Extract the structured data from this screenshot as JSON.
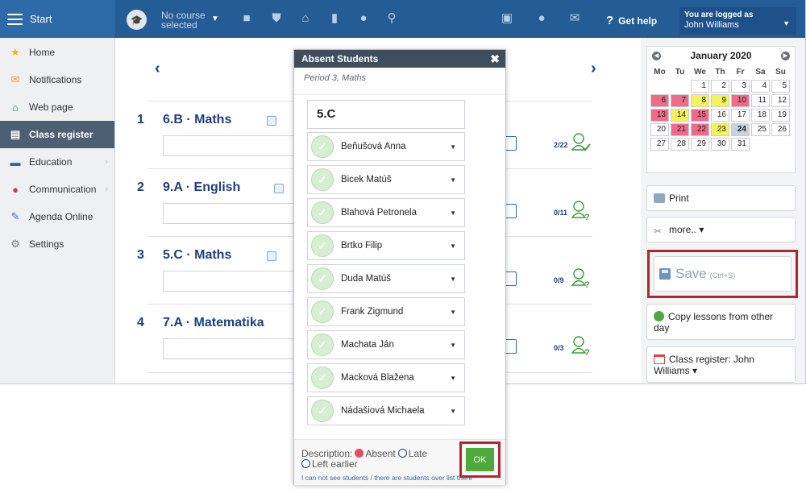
{
  "topbar": {
    "start_label": "Start",
    "course_label": "No course selected",
    "help_label": "Get help",
    "login_title": "You are logged as",
    "login_user": "John Williams",
    "icons": [
      "briefcase-icon",
      "shield-icon",
      "institution-icon",
      "chart-icon",
      "globe-icon",
      "walking-people-icon",
      "screen-icon",
      "chat-icon",
      "mail-icon"
    ]
  },
  "sidebar": {
    "items": [
      {
        "label": "Home",
        "icon": "star-icon"
      },
      {
        "label": "Notifications",
        "icon": "envelope-icon"
      },
      {
        "label": "Web page",
        "icon": "house-icon"
      },
      {
        "label": "Class register",
        "icon": "register-icon",
        "active": true
      },
      {
        "label": "Education",
        "icon": "book-icon"
      },
      {
        "label": "Communication",
        "icon": "chat-icon"
      },
      {
        "label": "Agenda Online",
        "icon": "pen-icon"
      },
      {
        "label": "Settings",
        "icon": "gear-icon"
      }
    ]
  },
  "main": {
    "prev_arrow": "‹",
    "next_arrow": "›",
    "lessons": [
      {
        "num": "1",
        "title": "6.B · Maths",
        "count": "2/22"
      },
      {
        "num": "2",
        "title": "9.A · English",
        "count": "0/11"
      },
      {
        "num": "3",
        "title": "5.C · Maths",
        "count": "0/9"
      },
      {
        "num": "4",
        "title": "7.A · Matematika",
        "count": "0/3"
      }
    ]
  },
  "calendar": {
    "title": "January 2020",
    "dow": [
      "Mo",
      "Tu",
      "We",
      "Th",
      "Fr",
      "Sa",
      "Su"
    ],
    "days": [
      {
        "d": ""
      },
      {
        "d": ""
      },
      {
        "d": "1"
      },
      {
        "d": "2"
      },
      {
        "d": "3"
      },
      {
        "d": "4"
      },
      {
        "d": "5"
      },
      {
        "d": "6",
        "c": "red"
      },
      {
        "d": "7",
        "c": "red"
      },
      {
        "d": "8",
        "c": "yellow"
      },
      {
        "d": "9",
        "c": "yellow"
      },
      {
        "d": "10",
        "c": "red"
      },
      {
        "d": "11"
      },
      {
        "d": "12"
      },
      {
        "d": "13",
        "c": "red"
      },
      {
        "d": "14",
        "c": "yellow"
      },
      {
        "d": "15",
        "c": "red"
      },
      {
        "d": "16"
      },
      {
        "d": "17"
      },
      {
        "d": "18"
      },
      {
        "d": "19"
      },
      {
        "d": "20"
      },
      {
        "d": "21",
        "c": "red"
      },
      {
        "d": "22",
        "c": "red"
      },
      {
        "d": "23",
        "c": "yellow"
      },
      {
        "d": "24",
        "c": "today"
      },
      {
        "d": "25"
      },
      {
        "d": "26"
      },
      {
        "d": "27"
      },
      {
        "d": "28"
      },
      {
        "d": "29"
      },
      {
        "d": "30"
      },
      {
        "d": "31"
      },
      {
        "d": ""
      },
      {
        "d": ""
      }
    ]
  },
  "right": {
    "print_label": "Print",
    "more_label": "more.. ▾",
    "save_label": "Save",
    "save_shortcut": "(Ctrl+S)",
    "copy_label": "Copy lessons from other day",
    "register_label": "Class register: John Williams ▾"
  },
  "dialog": {
    "title": "Absent Students",
    "close": "✖",
    "subtitle": "Period 3, Maths",
    "class_name": "5.C",
    "students": [
      "Beňušová Anna",
      "Bicek Matúš",
      "Blahová Petronela",
      "Brtko Filip",
      "Duda Matúš",
      "Frank Zigmund",
      "Machata Ján",
      "Macková Blažena",
      "Nádašiová Michaela"
    ],
    "desc_label": "Description:",
    "absent_label": "Absent",
    "late_label": "Late",
    "early_label": "Left earlier",
    "cant_see": "I can not see students / there are students over list there",
    "ok_label": "OK"
  },
  "colors": {
    "topbar": "#2d6aa8",
    "sidebar_active": "#4d5f73",
    "accent_red": "#b1262f",
    "ok_green": "#4daa3a",
    "cal_red": "#f06a8a",
    "cal_yellow": "#f3f35a"
  }
}
